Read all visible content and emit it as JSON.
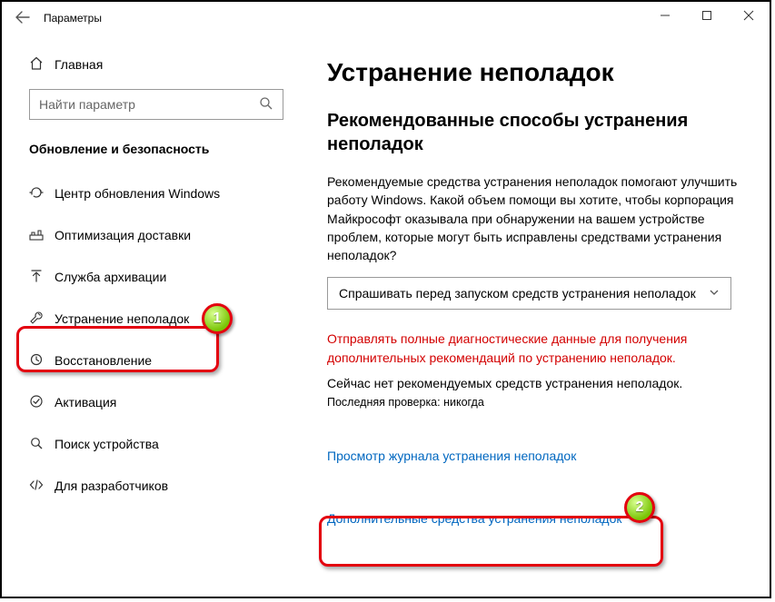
{
  "titlebar": {
    "title": "Параметры"
  },
  "sidebar": {
    "home": "Главная",
    "search_placeholder": "Найти параметр",
    "section": "Обновление и безопасность",
    "items": [
      {
        "label": "Центр обновления Windows"
      },
      {
        "label": "Оптимизация доставки"
      },
      {
        "label": "Служба архивации"
      },
      {
        "label": "Устранение неполадок"
      },
      {
        "label": "Восстановление"
      },
      {
        "label": "Активация"
      },
      {
        "label": "Поиск устройства"
      },
      {
        "label": "Для разработчиков"
      }
    ]
  },
  "content": {
    "h1": "Устранение неполадок",
    "h2": "Рекомендованные способы устранения неполадок",
    "body": "Рекомендуемые средства устранения неполадок помогают улучшить работу Windows. Какой объем помощи вы хотите, чтобы корпорация Майкрософт оказывала при обнаружении на вашем устройстве проблем, которые могут быть исправлены средствами устранения неполадок?",
    "dropdown_value": "Спрашивать перед запуском средств устранения неполадок",
    "red_text": "Отправлять полные диагностические данные для получения дополнительных рекомендаций по устранению неполадок.",
    "status": "Сейчас нет рекомендуемых средств устранения неполадок.",
    "last_check": "Последняя проверка: никогда",
    "link_history": "Просмотр журнала устранения неполадок",
    "link_more": "Дополнительные средства устранения неполадок"
  }
}
